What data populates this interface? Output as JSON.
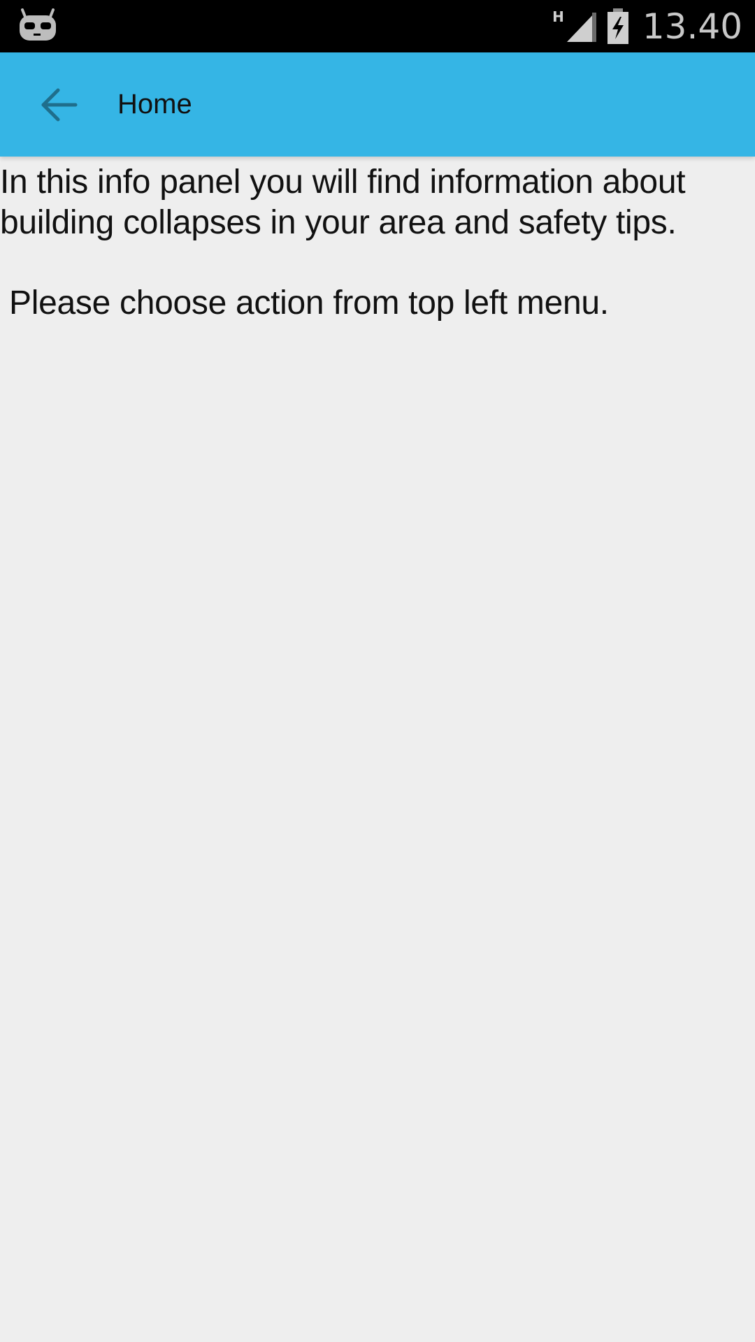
{
  "status_bar": {
    "network_type": "H",
    "time": "13.40",
    "icons": [
      "cyanogenmod-icon",
      "signal-icon",
      "battery-charging-icon"
    ]
  },
  "app_bar": {
    "title": "Home",
    "back_icon": "arrow-back-icon",
    "background_color": "#35b5e5"
  },
  "content": {
    "intro": "In this info panel you will find information about building collapses in your area and safety tips.",
    "instruction": "Please choose action from top left menu."
  }
}
